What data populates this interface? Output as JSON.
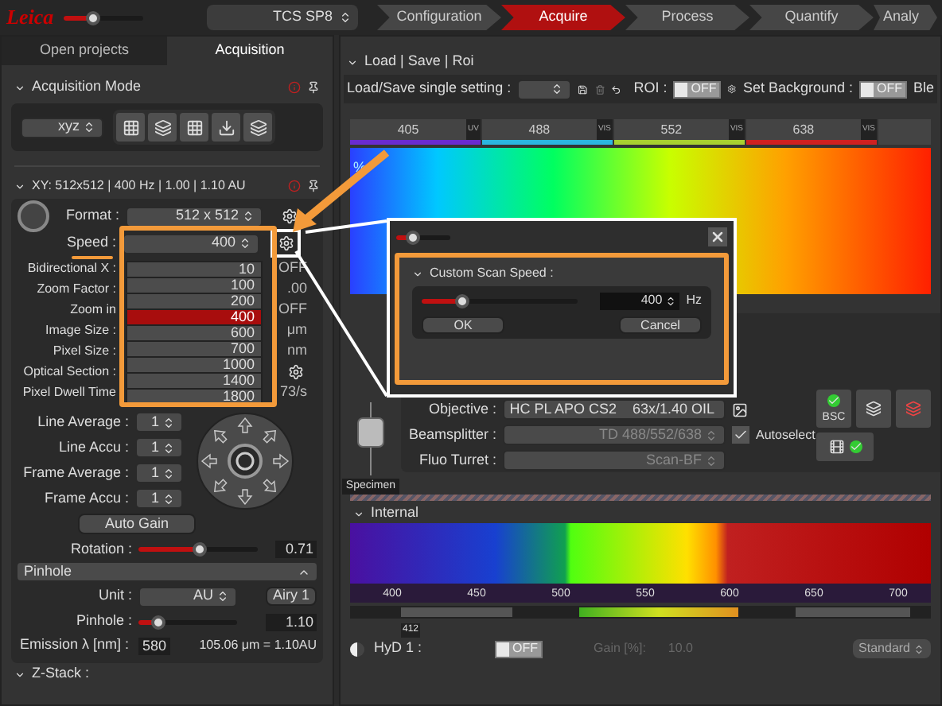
{
  "header": {
    "logo": "Leica",
    "slider": {
      "level": 0.35
    },
    "system": "TCS SP8",
    "tabs": [
      {
        "label": "Configuration",
        "selected": false
      },
      {
        "label": "Acquire",
        "selected": true
      },
      {
        "label": "Process",
        "selected": false
      },
      {
        "label": "Quantify",
        "selected": false
      },
      {
        "label": "Analy",
        "selected": false
      }
    ]
  },
  "left_panel": {
    "tabs": [
      {
        "label": "Open projects",
        "selected": false
      },
      {
        "label": "Acquisition",
        "selected": true
      }
    ],
    "acquisition_mode": {
      "title": "Acquisition Mode",
      "mode": "xyz"
    },
    "xy": {
      "title": "XY: 512x512 | 400 Hz | 1.00 | 1.10 AU",
      "format_label": "Format :",
      "format": "512 x 512",
      "speed_label": "Speed :",
      "speed": "400",
      "rows": [
        {
          "label": "Bidirectional X :",
          "value": "OFF"
        },
        {
          "label": "Zoom Factor :",
          "value": ".00"
        },
        {
          "label": "Zoom in",
          "value": "OFF"
        },
        {
          "label": "Image Size :",
          "value": "μm"
        },
        {
          "label": "Pixel Size :",
          "value": "nm"
        },
        {
          "label": "Optical Section :",
          "value": ""
        },
        {
          "label": "Pixel Dwell Time",
          "value": "73/s"
        }
      ],
      "speed_options": [
        {
          "label": "10",
          "selected": false
        },
        {
          "label": "100",
          "selected": false
        },
        {
          "label": "200",
          "selected": false
        },
        {
          "label": "400",
          "selected": true
        },
        {
          "label": "600",
          "selected": false
        },
        {
          "label": "700",
          "selected": false
        },
        {
          "label": "1000",
          "selected": false
        },
        {
          "label": "1400",
          "selected": false
        },
        {
          "label": "1800",
          "selected": false
        }
      ],
      "averages": [
        {
          "label": "Line Average :",
          "value": "1"
        },
        {
          "label": "Line Accu :",
          "value": "1"
        },
        {
          "label": "Frame Average :",
          "value": "1"
        },
        {
          "label": "Frame Accu :",
          "value": "1"
        }
      ],
      "auto_gain": "Auto Gain",
      "rotation": {
        "label": "Rotation :",
        "level": 0.5,
        "value": "0.71"
      }
    },
    "pinhole": {
      "title": "Pinhole",
      "unit_label": "Unit :",
      "unit": "AU",
      "airy": "Airy 1",
      "pinhole_label": "Pinhole :",
      "level": 0.2,
      "value": "1.10",
      "emission_label": "Emission λ [nm] :",
      "emission": "580",
      "result": "105.06 μm = 1.10AU"
    },
    "z_stack": {
      "title": "Z-Stack :"
    }
  },
  "right_panel": {
    "title": "Load | Save | Roi",
    "setting_label": "Load/Save single setting :",
    "roi_label": "ROI :",
    "roi": {
      "on": false,
      "text": "OFF"
    },
    "background_label": "Set Background :",
    "background": {
      "on": false,
      "text": "OFF"
    },
    "cut_label": "Ble",
    "lasers": [
      {
        "label": "405",
        "tag": "UV",
        "color": "#6a2bd0"
      },
      {
        "label": "488",
        "tag": "VIS",
        "color": "#2bb6e0"
      },
      {
        "label": "552",
        "tag": "VIS",
        "color": "#a8d030"
      },
      {
        "label": "638",
        "tag": "VIS",
        "color": "#d02020"
      }
    ],
    "spectrum_label": "%",
    "objective_label": "Objective :",
    "objective": "HC PL APO CS2    63x/1.40 OIL",
    "beamsplitter_label": "Beamsplitter :",
    "beamsplitter": "TD 488/552/638",
    "autoselect": {
      "label": "Autoselect",
      "checked": true
    },
    "turret_label": "Fluo Turret :",
    "turret": "Scan-BF",
    "bsc": "BSC",
    "specimen": "Specimen",
    "internal": {
      "title": "Internal",
      "ticks": [
        "400",
        "450",
        "500",
        "550",
        "600",
        "650",
        "700"
      ],
      "marker": "412",
      "detector": "HyD 1 :",
      "detector_toggle": {
        "on": false,
        "text": "OFF"
      },
      "gain_label": "Gain [%]:",
      "gain": "10.0",
      "mode": "Standard"
    }
  },
  "dialog": {
    "top_slider": {
      "level": 0.3
    },
    "title": "Custom Scan Speed :",
    "level": 0.25,
    "value": "400",
    "unit": "Hz",
    "ok": "OK",
    "cancel": "Cancel"
  }
}
